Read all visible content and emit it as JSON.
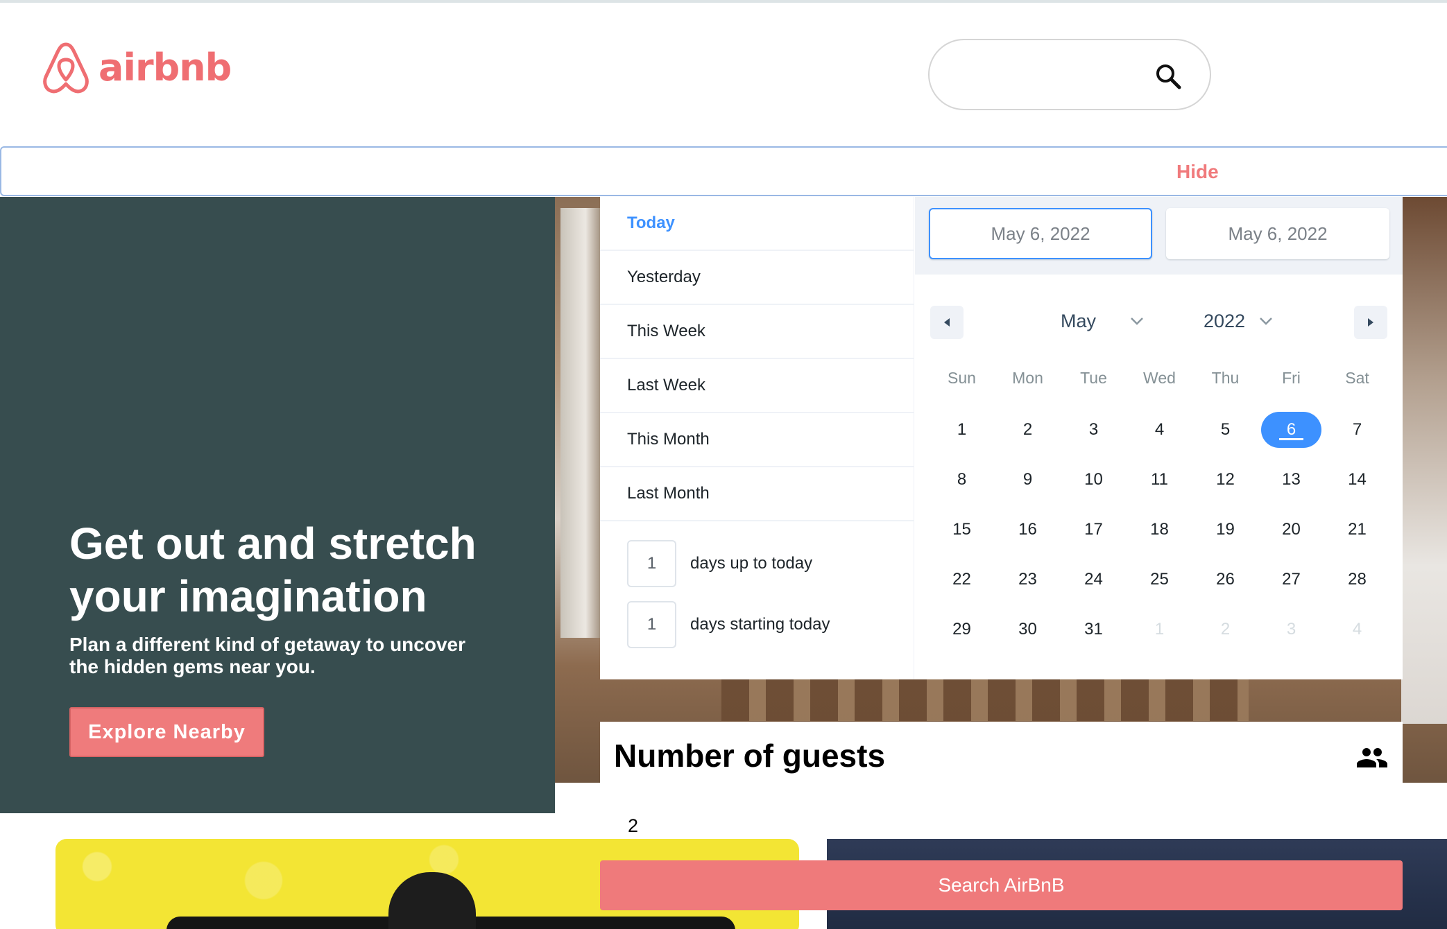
{
  "header": {
    "logo_text": "airbnb",
    "logo_icon": "airbnb-belo-icon",
    "search_icon": "search-icon",
    "search_value": ""
  },
  "hide_bar": {
    "label": "Hide"
  },
  "hero": {
    "title": "Get out and stretch your imagination",
    "subtitle": "Plan a different kind of getaway to uncover the hidden gems near you.",
    "cta_label": "Explore Nearby"
  },
  "date_picker": {
    "ranges": [
      {
        "label": "Today",
        "active": true
      },
      {
        "label": "Yesterday",
        "active": false
      },
      {
        "label": "This Week",
        "active": false
      },
      {
        "label": "Last Week",
        "active": false
      },
      {
        "label": "This Month",
        "active": false
      },
      {
        "label": "Last Month",
        "active": false
      }
    ],
    "input_ranges": [
      {
        "value": "1",
        "caption": "days up to today"
      },
      {
        "value": "1",
        "caption": "days starting today"
      }
    ],
    "start_date": "May 6, 2022",
    "end_date": "May 6, 2022",
    "month": "May",
    "year": "2022",
    "weekdays": [
      "Sun",
      "Mon",
      "Tue",
      "Wed",
      "Thu",
      "Fri",
      "Sat"
    ],
    "days": [
      "1",
      "2",
      "3",
      "4",
      "5",
      "6",
      "7",
      "8",
      "9",
      "10",
      "11",
      "12",
      "13",
      "14",
      "15",
      "16",
      "17",
      "18",
      "19",
      "20",
      "21",
      "22",
      "23",
      "24",
      "25",
      "26",
      "27",
      "28",
      "29",
      "30",
      "31",
      "1",
      "2",
      "3",
      "4"
    ],
    "passive_from_index": 31,
    "selected_index": 5,
    "colors": {
      "accent": "#3d91ff",
      "passive": "#d5dce0"
    }
  },
  "guests": {
    "title": "Number of guests",
    "icon": "people-icon",
    "value": "2",
    "submit_label": "Search AirBnB"
  },
  "colors": {
    "brand": "#ef6e72",
    "hero_bg": "#374d4f",
    "button": "#ef7b7c"
  }
}
